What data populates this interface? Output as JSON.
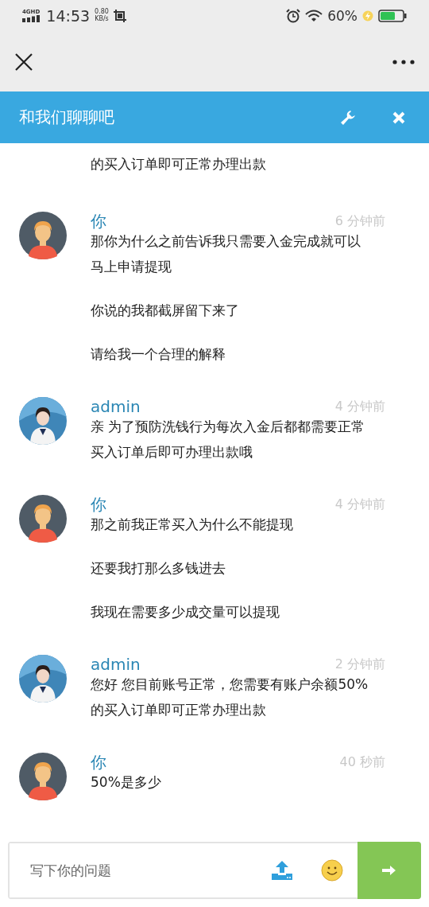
{
  "status_bar": {
    "network": "4GHD",
    "time": "14:53",
    "speed_value": "0.80",
    "speed_unit": "KB/s",
    "battery_percent": "60%"
  },
  "header": {
    "title": "和我们聊聊吧"
  },
  "messages": [
    {
      "kind": "fragment",
      "paragraphs": [
        [
          "的买入订单即可正常办理出款"
        ]
      ]
    },
    {
      "kind": "user",
      "name": "你",
      "time": "6 分钟前",
      "paragraphs": [
        [
          "那你为什么之前告诉我只需要入金完成就可以",
          "马上申请提现"
        ],
        [
          "你说的我都截屏留下来了"
        ],
        [
          "请给我一个合理的解释"
        ]
      ]
    },
    {
      "kind": "agent",
      "name": "admin",
      "time": "4 分钟前",
      "paragraphs": [
        [
          "亲 为了预防洗钱行为每次入金后都都需要正常",
          "买入订单后即可办理出款哦"
        ]
      ]
    },
    {
      "kind": "user",
      "name": "你",
      "time": "4 分钟前",
      "paragraphs": [
        [
          "那之前我正常买入为什么不能提现"
        ],
        [
          "还要我打那么多钱进去"
        ],
        [
          "我现在需要多少成交量可以提现"
        ]
      ]
    },
    {
      "kind": "agent",
      "name": "admin",
      "time": "2 分钟前",
      "paragraphs": [
        [
          "您好 您目前账号正常，您需要有账户余额50%",
          "的买入订单即可正常办理出款"
        ]
      ]
    },
    {
      "kind": "user",
      "name": "你",
      "time": "40 秒前",
      "paragraphs": [
        [
          "50%是多少"
        ]
      ]
    }
  ],
  "composer": {
    "placeholder": "写下你的问题"
  }
}
